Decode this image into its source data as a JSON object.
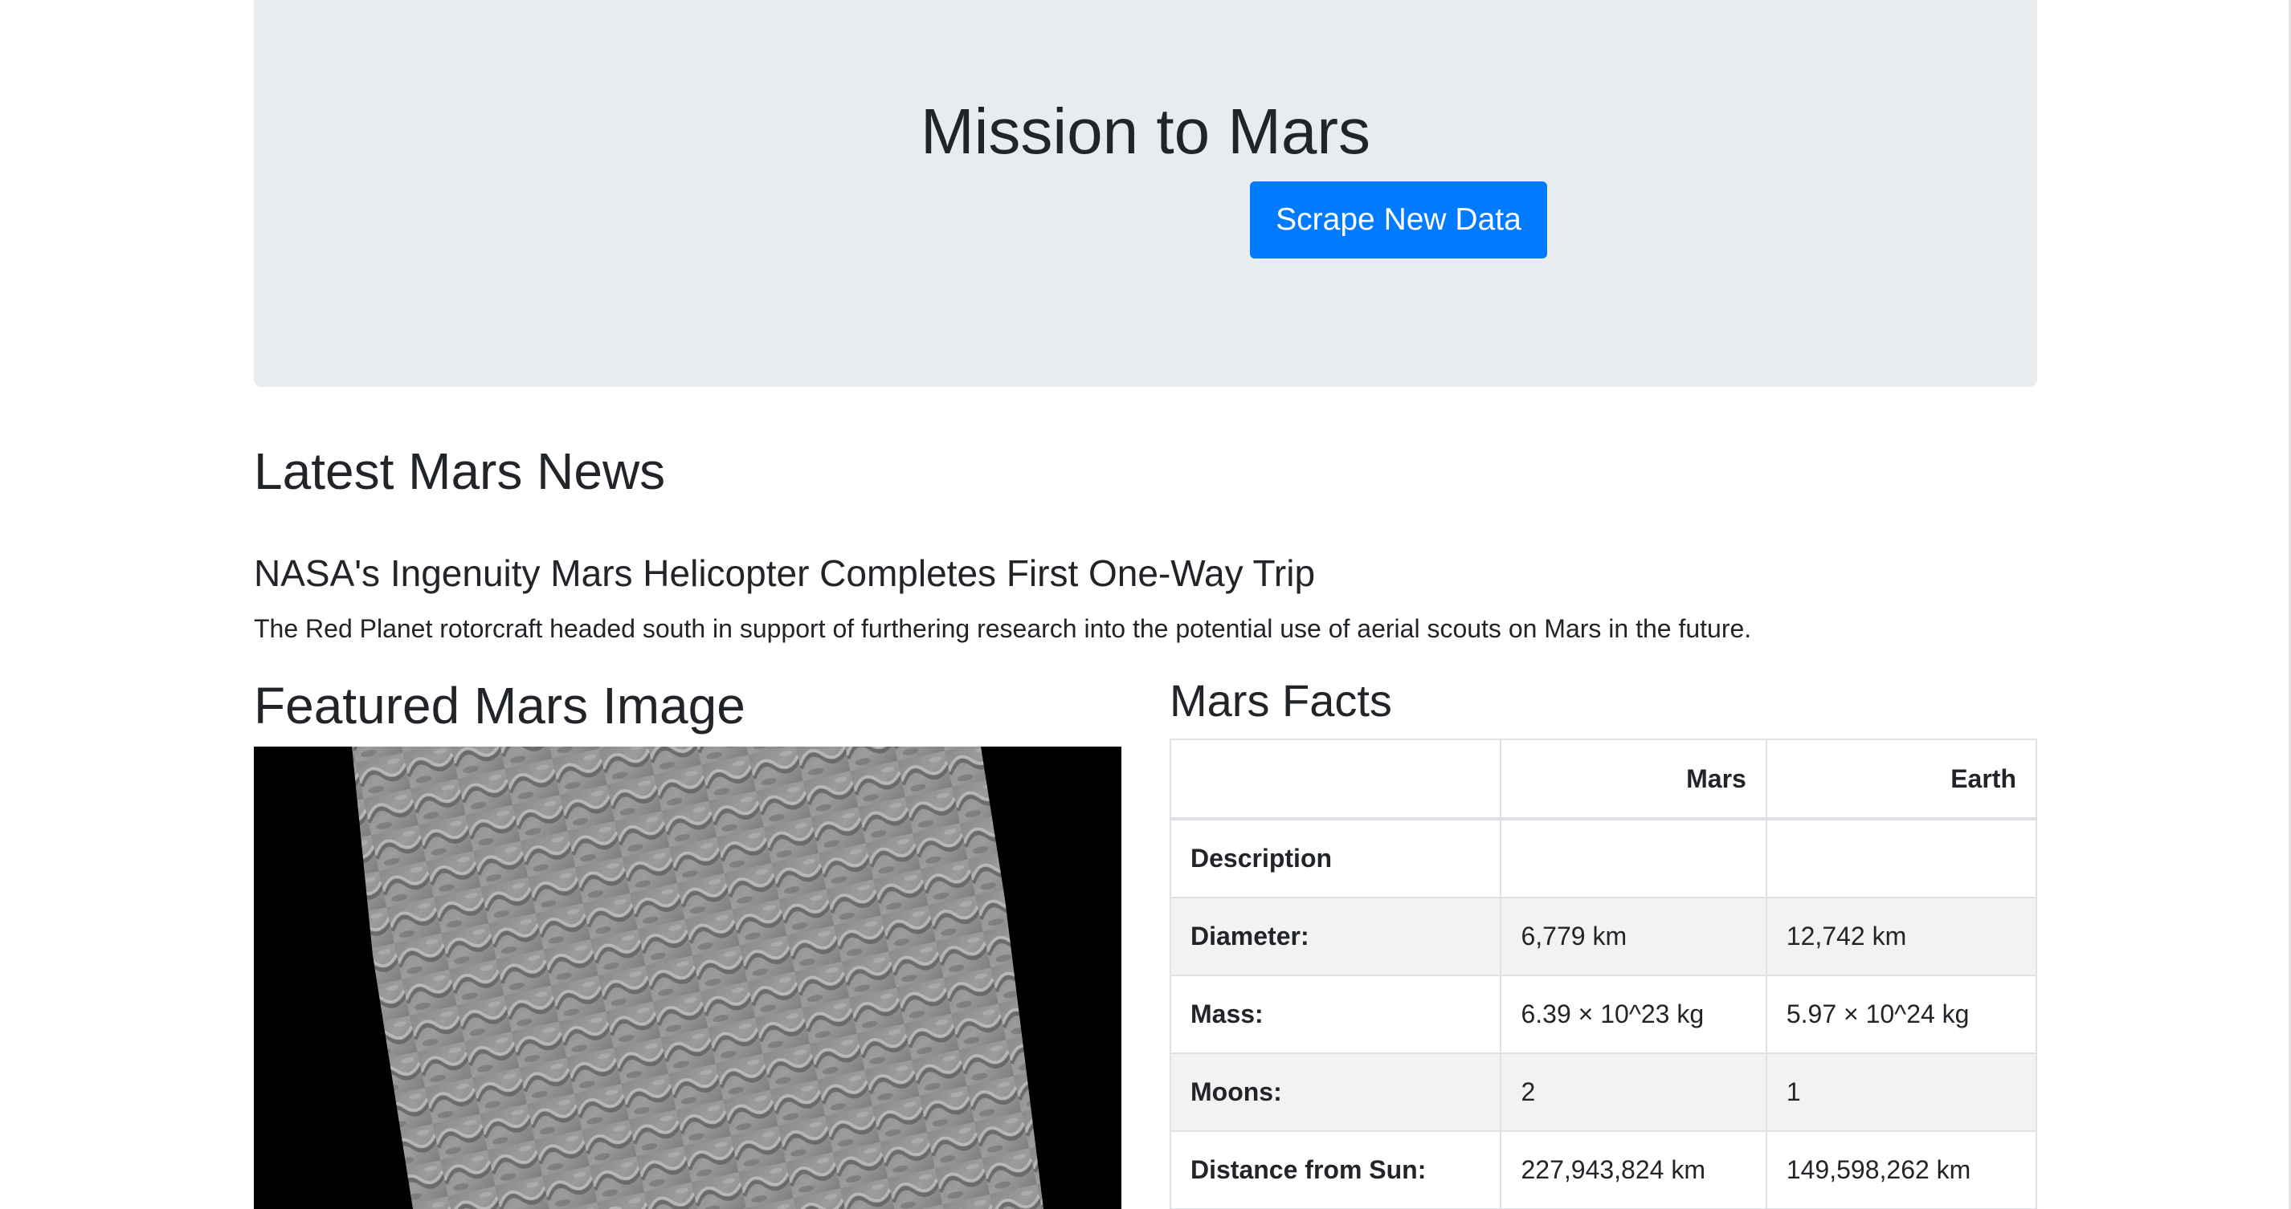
{
  "header": {
    "title": "Mission to Mars",
    "scrape_button_label": "Scrape New Data"
  },
  "news": {
    "section_heading": "Latest Mars News",
    "title": "NASA's Ingenuity Mars Helicopter Completes First One-Way Trip",
    "teaser": "The Red Planet rotorcraft headed south in support of furthering research into the potential use of aerial scouts on Mars in the future."
  },
  "featured_image": {
    "section_heading": "Featured Mars Image"
  },
  "facts": {
    "section_heading": "Mars Facts",
    "columns": [
      "",
      "Mars",
      "Earth"
    ],
    "rows": [
      {
        "label": "Description",
        "mars": "",
        "earth": ""
      },
      {
        "label": "Diameter:",
        "mars": "6,779 km",
        "earth": "12,742 km"
      },
      {
        "label": "Mass:",
        "mars": "6.39 × 10^23 kg",
        "earth": "5.97 × 10^24 kg"
      },
      {
        "label": "Moons:",
        "mars": "2",
        "earth": "1"
      },
      {
        "label": "Distance from Sun:",
        "mars": "227,943,824 km",
        "earth": "149,598,262 km"
      }
    ]
  },
  "colors": {
    "jumbotron_bg": "#e9ecef",
    "primary_button": "#007bff",
    "text": "#212529",
    "table_border": "#dee2e6",
    "table_stripe": "#f2f2f2"
  }
}
